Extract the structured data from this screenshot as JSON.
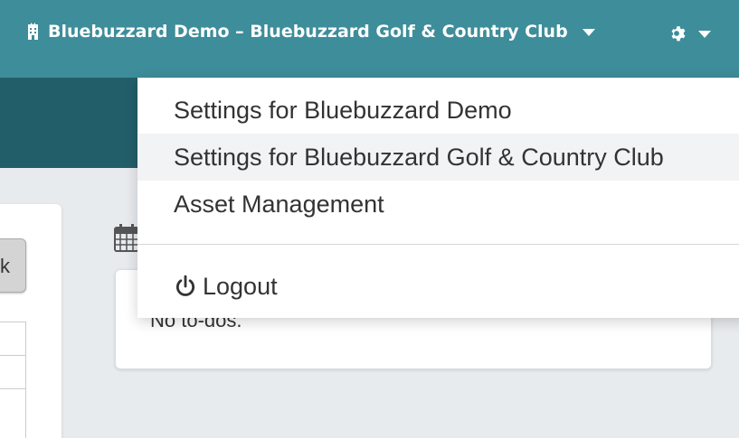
{
  "header": {
    "org_name": "Bluebuzzard Demo – Bluebuzzard Golf & Country Club",
    "icons": {
      "org": "building-icon",
      "settings": "gear-icon",
      "caret": "caret-down-icon"
    }
  },
  "dropdown": {
    "items": [
      {
        "label": "Settings for Bluebuzzard Demo",
        "active": false
      },
      {
        "label": "Settings for Bluebuzzard Golf & Country Club",
        "active": true
      },
      {
        "label": "Asset Management",
        "active": false
      }
    ],
    "logout_label": "Logout",
    "logout_icon": "power-icon"
  },
  "left_panel": {
    "button_label": "k"
  },
  "todo": {
    "empty_text": "No to-dos.",
    "icon": "calendar-icon"
  },
  "colors": {
    "topbar": "#3e8d9a",
    "subheader": "#225e6a",
    "background": "#e8ebee",
    "highlight": "#f2f3f4"
  }
}
